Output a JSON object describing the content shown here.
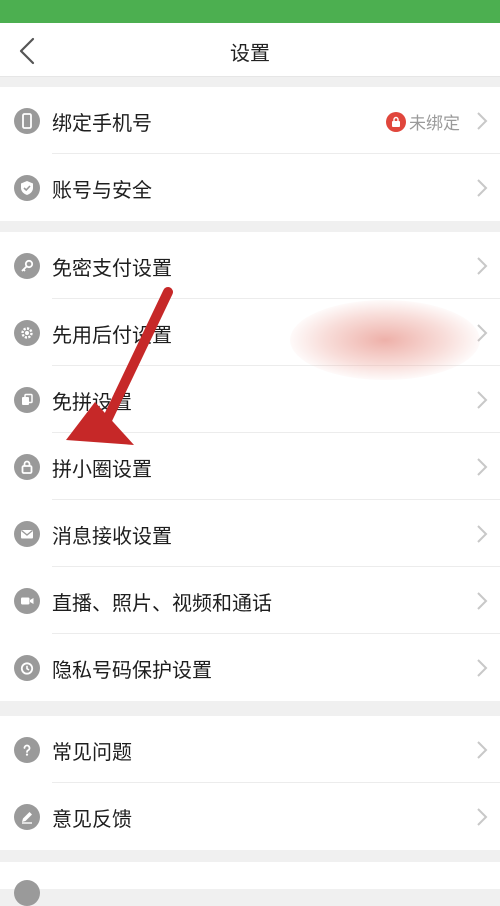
{
  "header": {
    "title": "设置"
  },
  "groups": [
    {
      "items": [
        {
          "label": "绑定手机号",
          "icon": "phone-icon",
          "status": "未绑定"
        },
        {
          "label": "账号与安全",
          "icon": "shield-icon"
        }
      ]
    },
    {
      "items": [
        {
          "label": "免密支付设置",
          "icon": "key-icon"
        },
        {
          "label": "先用后付设置",
          "icon": "gear-icon"
        },
        {
          "label": "免拼设置",
          "icon": "copy-icon"
        },
        {
          "label": "拼小圈设置",
          "icon": "lock-icon"
        },
        {
          "label": "消息接收设置",
          "icon": "mail-icon"
        },
        {
          "label": "直播、照片、视频和通话",
          "icon": "video-icon"
        },
        {
          "label": "隐私号码保护设置",
          "icon": "clock-icon"
        }
      ]
    },
    {
      "items": [
        {
          "label": "常见问题",
          "icon": "question-icon"
        },
        {
          "label": "意见反馈",
          "icon": "pencil-icon"
        }
      ]
    }
  ],
  "colors": {
    "accent": "#4caf50",
    "warning": "#e0463c",
    "icon_gray": "#9a9a9a"
  }
}
